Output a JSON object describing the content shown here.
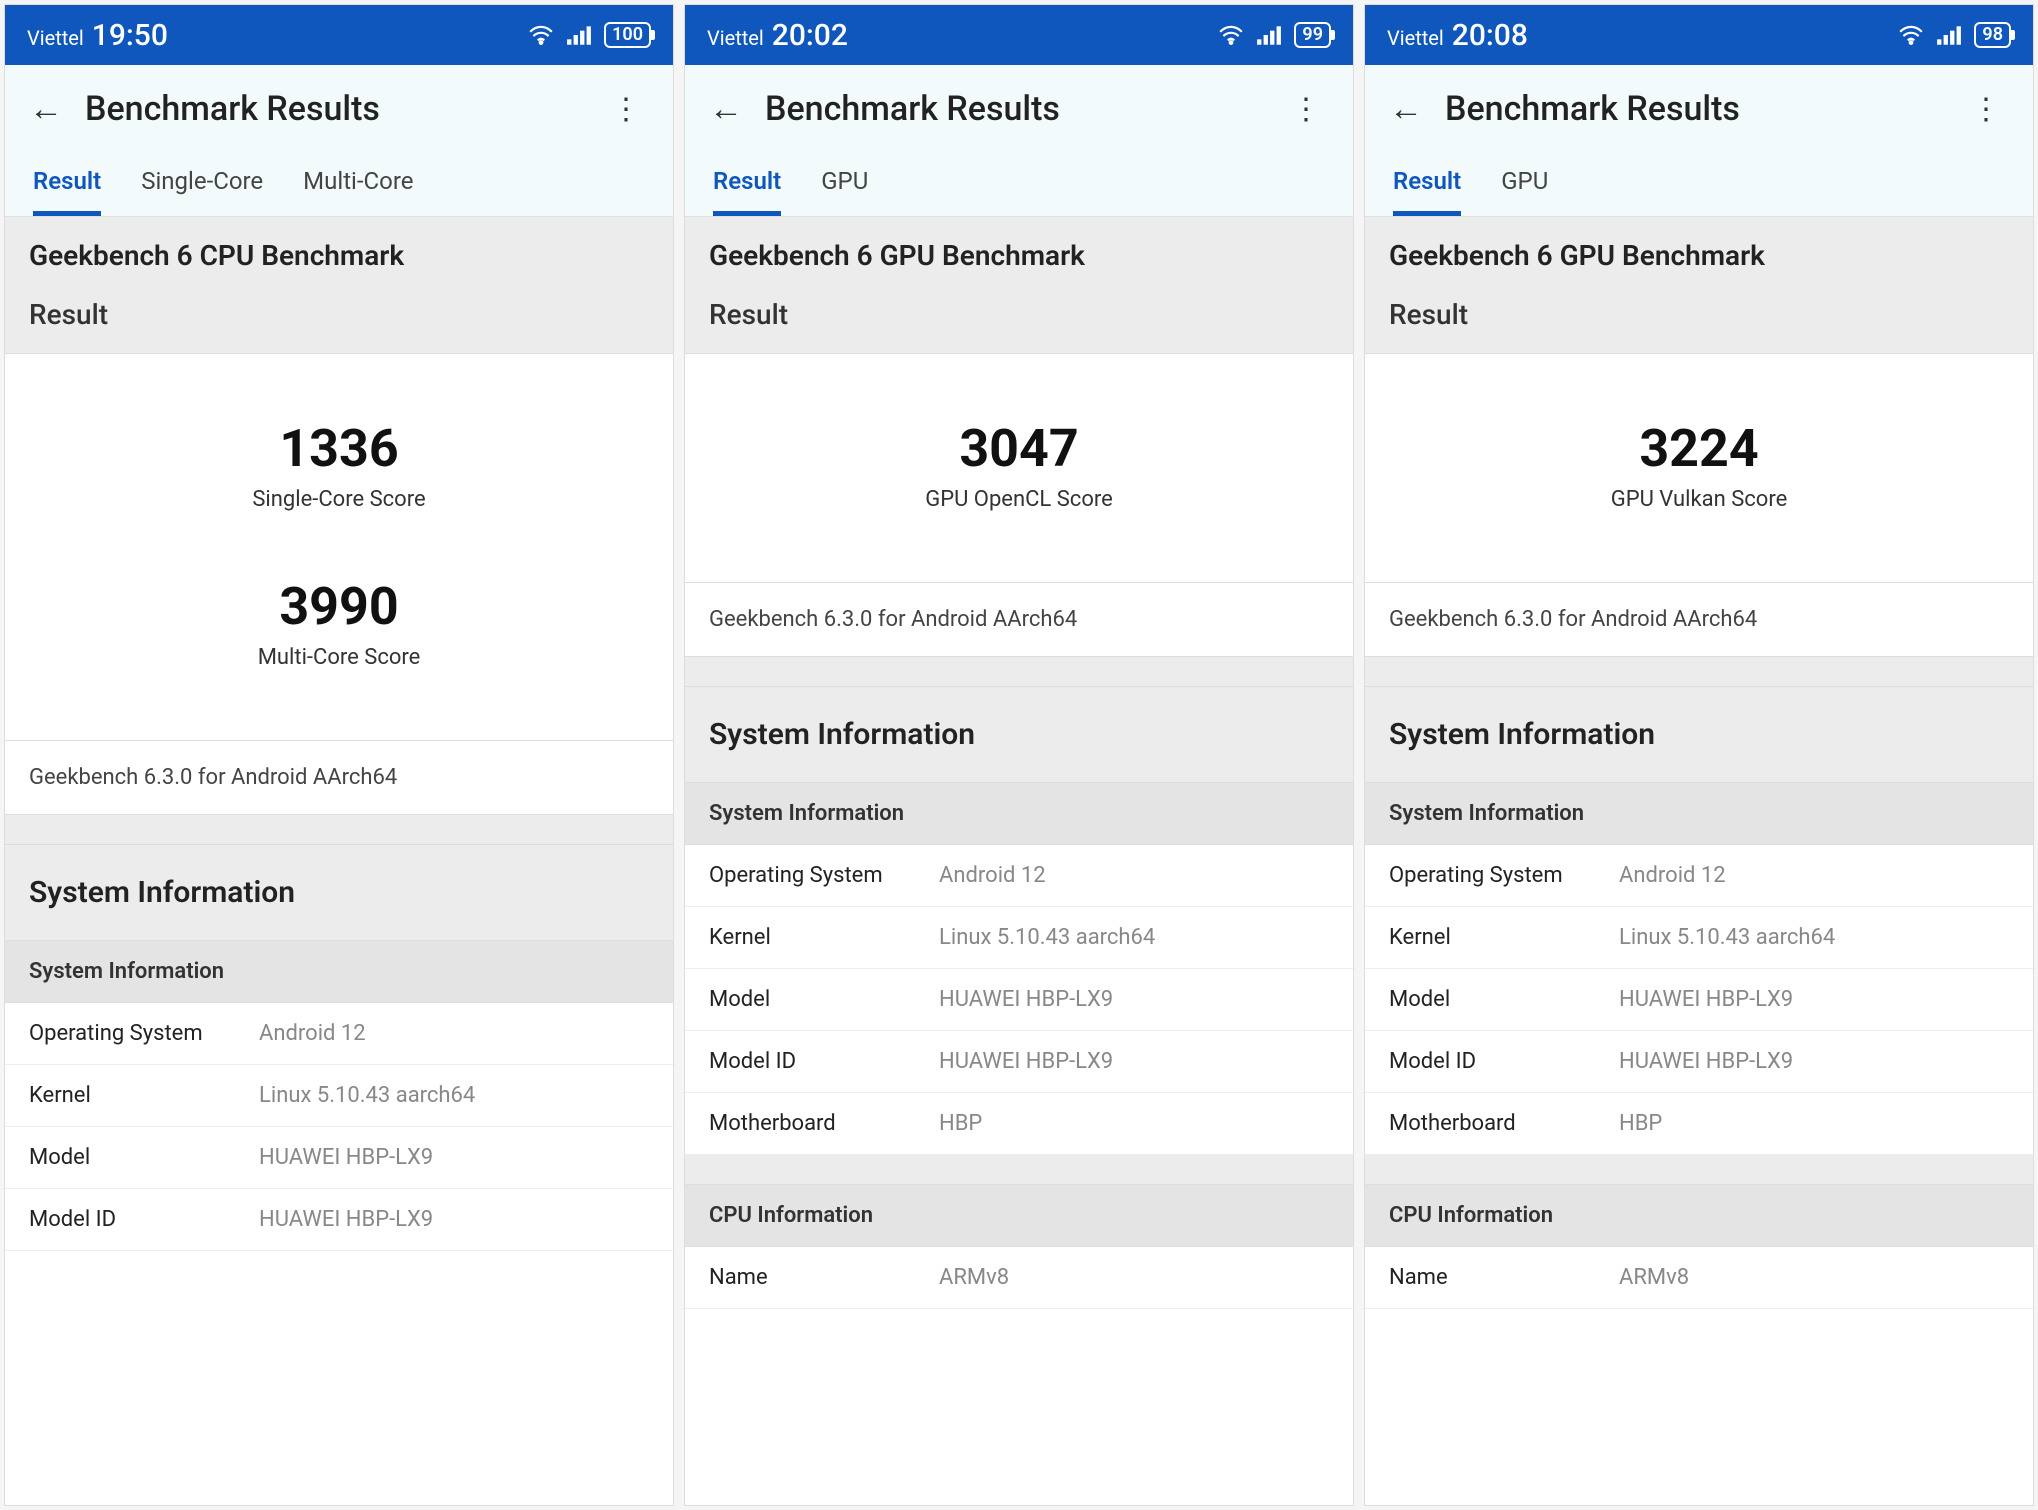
{
  "screens": [
    {
      "status": {
        "carrier": "Viettel",
        "time": "19:50",
        "battery": "100"
      },
      "appbar": {
        "title": "Benchmark Results"
      },
      "tabs": [
        {
          "label": "Result",
          "active": true
        },
        {
          "label": "Single-Core",
          "active": false
        },
        {
          "label": "Multi-Core",
          "active": false
        }
      ],
      "benchmark_title": "Geekbench 6 CPU Benchmark",
      "result_label": "Result",
      "scores": [
        {
          "value": "1336",
          "label": "Single-Core Score"
        },
        {
          "value": "3990",
          "label": "Multi-Core Score"
        }
      ],
      "version": "Geekbench 6.3.0 for Android AArch64",
      "sysinfo_heading": "System Information",
      "sysinfo_subheading": "System Information",
      "sysinfo": [
        {
          "k": "Operating System",
          "v": "Android 12"
        },
        {
          "k": "Kernel",
          "v": "Linux 5.10.43 aarch64"
        },
        {
          "k": "Model",
          "v": "HUAWEI HBP-LX9"
        },
        {
          "k": "Model ID",
          "v": "HUAWEI HBP-LX9"
        }
      ],
      "cpuinfo_subheading": null,
      "cpuinfo": []
    },
    {
      "status": {
        "carrier": "Viettel",
        "time": "20:02",
        "battery": "99"
      },
      "appbar": {
        "title": "Benchmark Results"
      },
      "tabs": [
        {
          "label": "Result",
          "active": true
        },
        {
          "label": "GPU",
          "active": false
        }
      ],
      "benchmark_title": "Geekbench 6 GPU Benchmark",
      "result_label": "Result",
      "scores": [
        {
          "value": "3047",
          "label": "GPU OpenCL Score"
        }
      ],
      "version": "Geekbench 6.3.0 for Android AArch64",
      "sysinfo_heading": "System Information",
      "sysinfo_subheading": "System Information",
      "sysinfo": [
        {
          "k": "Operating System",
          "v": "Android 12"
        },
        {
          "k": "Kernel",
          "v": "Linux 5.10.43 aarch64"
        },
        {
          "k": "Model",
          "v": "HUAWEI HBP-LX9"
        },
        {
          "k": "Model ID",
          "v": "HUAWEI HBP-LX9"
        },
        {
          "k": "Motherboard",
          "v": "HBP"
        }
      ],
      "cpuinfo_subheading": "CPU Information",
      "cpuinfo": [
        {
          "k": "Name",
          "v": "ARMv8"
        }
      ]
    },
    {
      "status": {
        "carrier": "Viettel",
        "time": "20:08",
        "battery": "98"
      },
      "appbar": {
        "title": "Benchmark Results"
      },
      "tabs": [
        {
          "label": "Result",
          "active": true
        },
        {
          "label": "GPU",
          "active": false
        }
      ],
      "benchmark_title": "Geekbench 6 GPU Benchmark",
      "result_label": "Result",
      "scores": [
        {
          "value": "3224",
          "label": "GPU Vulkan Score"
        }
      ],
      "version": "Geekbench 6.3.0 for Android AArch64",
      "sysinfo_heading": "System Information",
      "sysinfo_subheading": "System Information",
      "sysinfo": [
        {
          "k": "Operating System",
          "v": "Android 12"
        },
        {
          "k": "Kernel",
          "v": "Linux 5.10.43 aarch64"
        },
        {
          "k": "Model",
          "v": "HUAWEI HBP-LX9"
        },
        {
          "k": "Model ID",
          "v": "HUAWEI HBP-LX9"
        },
        {
          "k": "Motherboard",
          "v": "HBP"
        }
      ],
      "cpuinfo_subheading": "CPU Information",
      "cpuinfo": [
        {
          "k": "Name",
          "v": "ARMv8"
        }
      ]
    }
  ]
}
